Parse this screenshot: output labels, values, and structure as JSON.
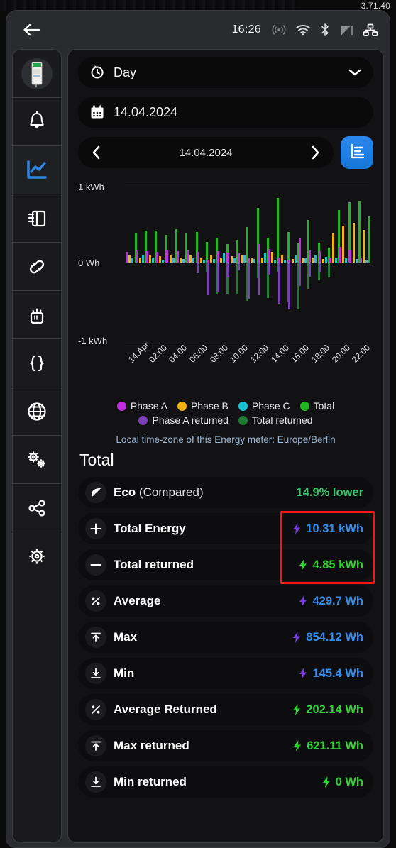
{
  "version": "3.71.40",
  "topbar": {
    "back_icon": "back-arrow-icon",
    "time": "16:26",
    "icons": [
      "rss-signal-icon",
      "wifi-icon",
      "bluetooth-icon",
      "cast-icon",
      "network-icon"
    ]
  },
  "sidebar": {
    "items": [
      {
        "name": "device-thumbnail",
        "icon": "din-rail-device-icon",
        "active": false
      },
      {
        "name": "alarms",
        "icon": "bell-icon",
        "active": false
      },
      {
        "name": "charts",
        "icon": "line-chart-icon",
        "active": true
      },
      {
        "name": "io-terminals",
        "icon": "terminal-block-icon",
        "active": false
      },
      {
        "name": "links",
        "icon": "chain-link-icon",
        "active": false
      },
      {
        "name": "button",
        "icon": "push-button-icon",
        "active": false
      },
      {
        "name": "json",
        "icon": "curly-braces-icon",
        "active": false
      },
      {
        "name": "network-web",
        "icon": "globe-icon",
        "active": false
      },
      {
        "name": "advanced-settings",
        "icon": "double-gears-icon",
        "active": false
      },
      {
        "name": "sharing",
        "icon": "share-nodes-icon",
        "active": false
      },
      {
        "name": "settings",
        "icon": "gear-icon",
        "active": false
      }
    ]
  },
  "controls": {
    "period": {
      "label": "Day",
      "icon": "history-icon",
      "chevron": "chevron-down-icon"
    },
    "date": {
      "value": "14.04.2024",
      "icon": "calendar-icon"
    },
    "nav": {
      "prev": "chevron-left-icon",
      "current": "14.04.2024",
      "next": "chevron-right-icon"
    },
    "chart_button": {
      "icon": "bar-chart-list-icon",
      "color": "#2a87ee"
    }
  },
  "chart_data": {
    "type": "bar",
    "title": "",
    "xlabel": "",
    "ylabel": "",
    "ylim": [
      -1000,
      1000
    ],
    "y_ticks": [
      "1 kWh",
      "0 Wh",
      "-1 kWh"
    ],
    "grid": true,
    "legend_position": "bottom",
    "categories": [
      "14.Apr",
      "01:00",
      "02:00",
      "03:00",
      "04:00",
      "05:00",
      "06:00",
      "07:00",
      "08:00",
      "09:00",
      "10:00",
      "11:00",
      "12:00",
      "13:00",
      "14:00",
      "15:00",
      "16:00",
      "17:00",
      "18:00",
      "19:00",
      "20:00",
      "21:00",
      "22:00",
      "23:00"
    ],
    "tick_labels": [
      "14.Apr",
      "02:00",
      "04:00",
      "06:00",
      "08:00",
      "10:00",
      "12:00",
      "14:00",
      "16:00",
      "18:00",
      "20:00",
      "22:00"
    ],
    "unit": "Wh",
    "series": [
      {
        "name": "Phase A",
        "color": "#c02ee0",
        "values": [
          145,
          160,
          150,
          140,
          170,
          150,
          160,
          140,
          35,
          150,
          130,
          120,
          60,
          240,
          175,
          70,
          35,
          320,
          160,
          150,
          70,
          210,
          165,
          60
        ]
      },
      {
        "name": "Phase B",
        "color": "#f2b211",
        "values": [
          95,
          60,
          90,
          80,
          105,
          70,
          95,
          55,
          90,
          55,
          80,
          100,
          70,
          60,
          145,
          105,
          50,
          60,
          60,
          45,
          380,
          490,
          520,
          430
        ]
      },
      {
        "name": "Phase C",
        "color": "#17c4d4",
        "values": [
          70,
          90,
          65,
          40,
          55,
          45,
          60,
          35,
          45,
          135,
          70,
          95,
          50,
          120,
          40,
          35,
          95,
          60,
          105,
          75,
          55,
          60,
          50,
          30
        ]
      },
      {
        "name": "Total",
        "color": "#22b522",
        "values": [
          395,
          420,
          420,
          365,
          440,
          395,
          400,
          275,
          325,
          245,
          295,
          470,
          720,
          330,
          854,
          400,
          250,
          560,
          265,
          195,
          690,
          790,
          810,
          610
        ]
      },
      {
        "name": "Phase A returned",
        "color": "#7b3fb8",
        "values": [
          0,
          0,
          0,
          0,
          0,
          0,
          0,
          -140,
          -430,
          -390,
          -200,
          -100,
          -480,
          -430,
          -160,
          -540,
          -620,
          -310,
          -190,
          -130,
          0,
          0,
          0,
          0
        ]
      },
      {
        "name": "Total returned",
        "color": "#1f7a32",
        "values": [
          0,
          0,
          0,
          0,
          0,
          0,
          0,
          -130,
          -420,
          -420,
          -420,
          -500,
          -210,
          -470,
          -120,
          -510,
          -621,
          -350,
          -230,
          -200,
          0,
          0,
          0,
          0
        ]
      }
    ],
    "legend": [
      {
        "label": "Phase A",
        "color": "#c02ee0"
      },
      {
        "label": "Phase B",
        "color": "#f2b211"
      },
      {
        "label": "Phase C",
        "color": "#17c4d4"
      },
      {
        "label": "Total",
        "color": "#22b522"
      },
      {
        "label": "Phase A returned",
        "color": "#7b3fb8"
      },
      {
        "label": "Total returned",
        "color": "#1f7a32"
      }
    ]
  },
  "timezone_note": "Local time-zone of this Energy meter: Europe/Berlin",
  "section_title": "Total",
  "stats": [
    {
      "icon": "leaf-icon",
      "label": "Eco",
      "suffix": " (Compared)",
      "value": "14.9% lower",
      "bolt": false,
      "color": "ecogreen"
    },
    {
      "icon": "plus-icon",
      "label": "Total Energy",
      "suffix": "",
      "value": "10.31 kWh",
      "bolt": true,
      "color": "blue"
    },
    {
      "icon": "minus-icon",
      "label": "Total returned",
      "suffix": "",
      "value": "4.85 kWh",
      "bolt": true,
      "color": "green"
    },
    {
      "icon": "percent-icon",
      "label": "Average",
      "suffix": "",
      "value": "429.7 Wh",
      "bolt": true,
      "color": "blue"
    },
    {
      "icon": "arrow-up-bar-icon",
      "label": "Max",
      "suffix": "",
      "value": "854.12 Wh",
      "bolt": true,
      "color": "blue"
    },
    {
      "icon": "arrow-down-bar-icon",
      "label": "Min",
      "suffix": "",
      "value": "145.4 Wh",
      "bolt": true,
      "color": "blue"
    },
    {
      "icon": "percent-icon",
      "label": "Average Returned",
      "suffix": "",
      "value": "202.14 Wh",
      "bolt": true,
      "color": "green"
    },
    {
      "icon": "arrow-up-bar-icon",
      "label": "Max returned",
      "suffix": "",
      "value": "621.11 Wh",
      "bolt": true,
      "color": "green"
    },
    {
      "icon": "arrow-down-bar-icon",
      "label": "Min returned",
      "suffix": "",
      "value": "0 Wh",
      "bolt": true,
      "color": "green"
    }
  ],
  "highlight": {
    "color": "#ff1414",
    "rows": [
      1,
      2
    ]
  }
}
